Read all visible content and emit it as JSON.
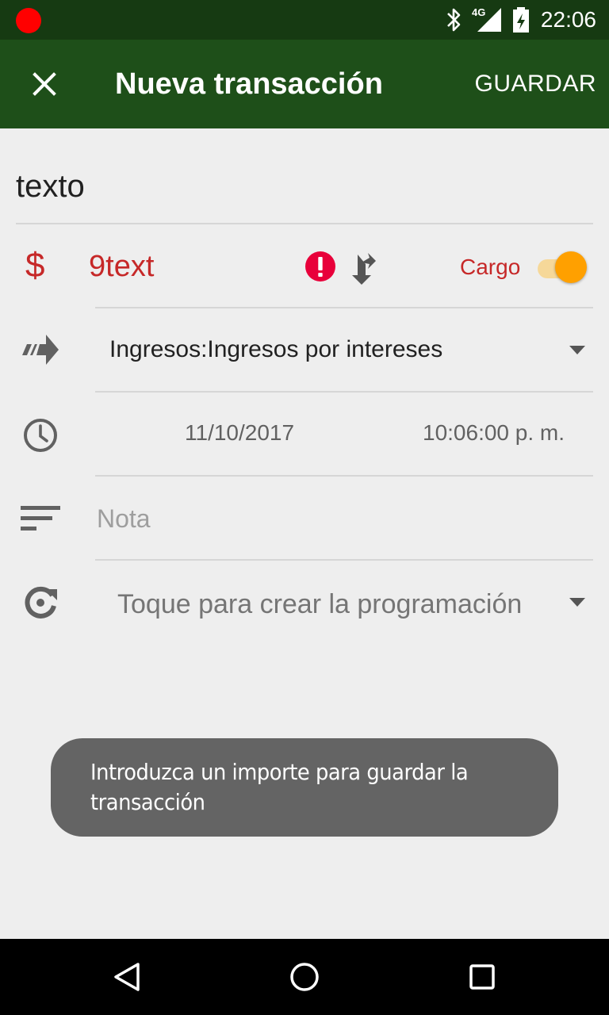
{
  "status_bar": {
    "time": "22:06",
    "network": "4G",
    "icons": [
      "recording-dot-icon",
      "bluetooth-icon",
      "signal-icon",
      "battery-charging-icon"
    ]
  },
  "toolbar": {
    "close_icon": "close-icon",
    "title": "Nueva transacción",
    "save_label": "GUARDAR"
  },
  "form": {
    "description": "texto",
    "amount": {
      "currency_symbol": "$",
      "value": "9text",
      "error_icon": "error-icon",
      "split_icon": "split-icon",
      "type_label": "Cargo",
      "type_toggle_on": true
    },
    "account": {
      "icon": "transfer-arrow-icon",
      "value": "Ingresos:Ingresos por intereses"
    },
    "datetime": {
      "icon": "clock-icon",
      "date": "11/10/2017",
      "time": "10:06:00 p. m."
    },
    "note": {
      "icon": "notes-icon",
      "placeholder": "Nota",
      "value": ""
    },
    "recurrence": {
      "icon": "recurrence-icon",
      "label": "Toque para crear la programación"
    }
  },
  "toast": {
    "message": "Introduzca un importe para guardar la transacción"
  },
  "nav_bar": {
    "icons": [
      "back-icon",
      "home-icon",
      "recents-icon"
    ]
  },
  "colors": {
    "status_bar": "#163a12",
    "toolbar": "#1e4f19",
    "negative_red": "#c62828",
    "toggle_accent": "#ffa000",
    "background": "#eeeeee"
  }
}
